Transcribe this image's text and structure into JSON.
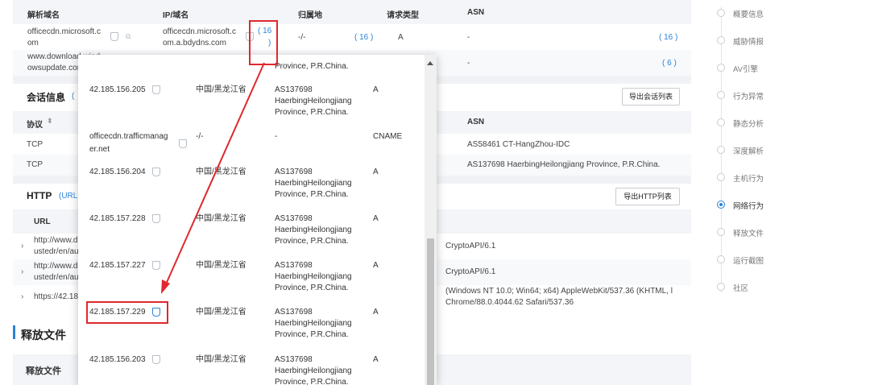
{
  "dns_table": {
    "headers": [
      "解析域名",
      "IP/域名",
      "归属地",
      "请求类型",
      "ASN"
    ],
    "rows": [
      {
        "domain_l1": "officecdn.microsoft.c",
        "domain_l2": "om",
        "ip_l1": "officecdn.microsoft.c",
        "ip_l2": "om.a.bdydns.com",
        "count_open": "( 16",
        "count_close": ")",
        "location": "-/-",
        "loc_count": "( 16 )",
        "req_type": "A",
        "asn": "-",
        "asn_count": "( 16 )"
      },
      {
        "domain_l1": "www.download.wind",
        "domain_l2": "owsupdate.com",
        "asn": "-",
        "asn_count": "( 6 )"
      }
    ]
  },
  "session": {
    "title": "会话信息",
    "subtitle_prefix": "(",
    "export_label": "导出会话列表",
    "headers": {
      "protocol": "协议",
      "sort_icon": "sort-icon",
      "asn": "ASN"
    },
    "rows": [
      {
        "protocol": "TCP",
        "asn": "AS58461 CT-HangZhou-IDC"
      },
      {
        "protocol": "TCP",
        "asn": "AS137698 HaerbingHeilongjiang Province, P.R.China."
      }
    ]
  },
  "http": {
    "title": "HTTP",
    "subtitle_prefix": "(URL",
    "export_label": "导出HTTP列表",
    "header_url": "URL",
    "rows": [
      {
        "url_l1": "http://www.do",
        "url_l2": "ustedr/en/au",
        "ua_l1": "CryptoAPI/6.1"
      },
      {
        "url_l1": "http://www.do",
        "url_l2": "ustedr/en/au",
        "ua_l1": "CryptoAPI/6.1"
      },
      {
        "url_l1": "https://42.18",
        "ua_l1": "(Windows NT 10.0; Win64; x64) AppleWebKit/537.36 (KHTML, l",
        "ua_l2": "Chrome/88.0.4044.62 Safari/537.36"
      }
    ]
  },
  "release": {
    "title": "释放文件",
    "sub_title": "释放文件"
  },
  "popup": {
    "top_partial": "Province, P.R.China.",
    "rows": [
      {
        "ip": "42.185.156.205",
        "region": "中国/黑龙江省",
        "asn_l1": "AS137698",
        "asn_l2": "HaerbingHeilongjiang",
        "asn_l3": "Province, P.R.China.",
        "type": "A"
      },
      {
        "ip_l1": "officecdn.trafficmanag",
        "ip_l2": "er.net",
        "region": "-/-",
        "asn_l1": "-",
        "type": "CNAME"
      },
      {
        "ip": "42.185.156.204",
        "region": "中国/黑龙江省",
        "asn_l1": "AS137698",
        "asn_l2": "HaerbingHeilongjiang",
        "asn_l3": "Province, P.R.China.",
        "type": "A"
      },
      {
        "ip": "42.185.157.228",
        "region": "中国/黑龙江省",
        "asn_l1": "AS137698",
        "asn_l2": "HaerbingHeilongjiang",
        "asn_l3": "Province, P.R.China.",
        "type": "A"
      },
      {
        "ip": "42.185.157.227",
        "region": "中国/黑龙江省",
        "asn_l1": "AS137698",
        "asn_l2": "HaerbingHeilongjiang",
        "asn_l3": "Province, P.R.China.",
        "type": "A"
      },
      {
        "ip": "42.185.157.229",
        "region": "中国/黑龙江省",
        "asn_l1": "AS137698",
        "asn_l2": "HaerbingHeilongjiang",
        "asn_l3": "Province, P.R.China.",
        "type": "A"
      },
      {
        "ip": "42.185.156.203",
        "region": "中国/黑龙江省",
        "asn_l1": "AS137698",
        "asn_l2": "HaerbingHeilongjiang",
        "asn_l3": "Province, P.R.China.",
        "type": "A"
      }
    ]
  },
  "sidebar": {
    "items": [
      {
        "label": "概要信息"
      },
      {
        "label": "威胁情报"
      },
      {
        "label": "AV引擎"
      },
      {
        "label": "行为异常"
      },
      {
        "label": "静态分析"
      },
      {
        "label": "深度解析"
      },
      {
        "label": "主机行为"
      },
      {
        "label": "网络行为",
        "active": true
      },
      {
        "label": "释放文件"
      },
      {
        "label": "运行截图"
      },
      {
        "label": "社区"
      }
    ]
  },
  "colors": {
    "accent": "#2b82d9",
    "annotation": "#e0282e",
    "header_bg": "#f3f5f8"
  }
}
